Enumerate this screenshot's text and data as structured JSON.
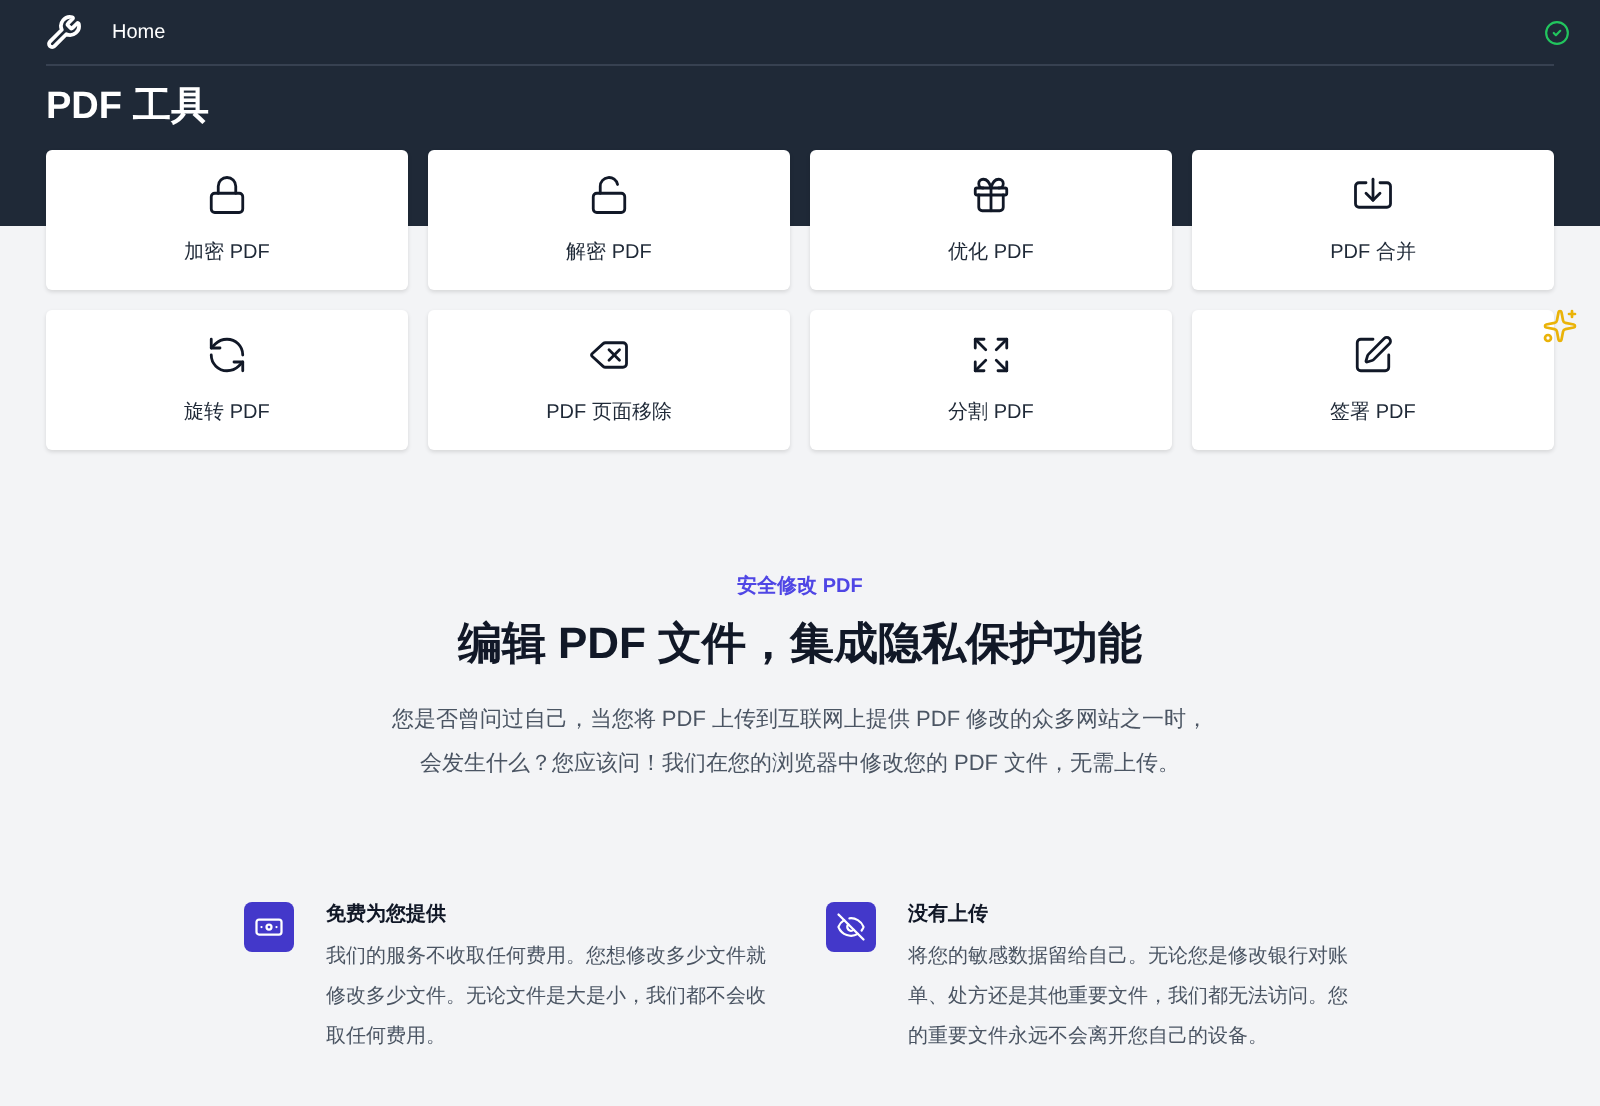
{
  "nav": {
    "home": "Home",
    "status_ok": true
  },
  "title": "PDF 工具",
  "tools": [
    {
      "kind": "lock",
      "label": "加密 PDF",
      "sparkle": false
    },
    {
      "kind": "unlock",
      "label": "解密 PDF",
      "sparkle": false
    },
    {
      "kind": "optimize",
      "label": "优化 PDF",
      "sparkle": false
    },
    {
      "kind": "merge",
      "label": "PDF 合并",
      "sparkle": false
    },
    {
      "kind": "rotate",
      "label": "旋转 PDF",
      "sparkle": false
    },
    {
      "kind": "remove",
      "label": "PDF 页面移除",
      "sparkle": false
    },
    {
      "kind": "split",
      "label": "分割 PDF",
      "sparkle": false
    },
    {
      "kind": "sign",
      "label": "签署 PDF",
      "sparkle": true
    }
  ],
  "intro": {
    "eyebrow": "安全修改 PDF",
    "heading": "编辑 PDF 文件，集成隐私保护功能",
    "lines": [
      "您是否曾问过自己，当您将 PDF 上传到互联网上提供 PDF 修改的众多网站之一时，",
      "会发生什么？您应该问！我们在您的浏览器中修改您的 PDF 文件，无需上传。"
    ]
  },
  "features": [
    {
      "kind": "free",
      "title": "免费为您提供",
      "text": "我们的服务不收取任何费用。您想修改多少文件就修改多少文件。无论文件是大是小，我们都不会收取任何费用。"
    },
    {
      "kind": "private",
      "title": "没有上传",
      "text": "将您的敏感数据留给自己。无论您是修改银行对账单、处方还是其他重要文件，我们都无法访问。您的重要文件永远不会离开您自己的设备。"
    }
  ]
}
